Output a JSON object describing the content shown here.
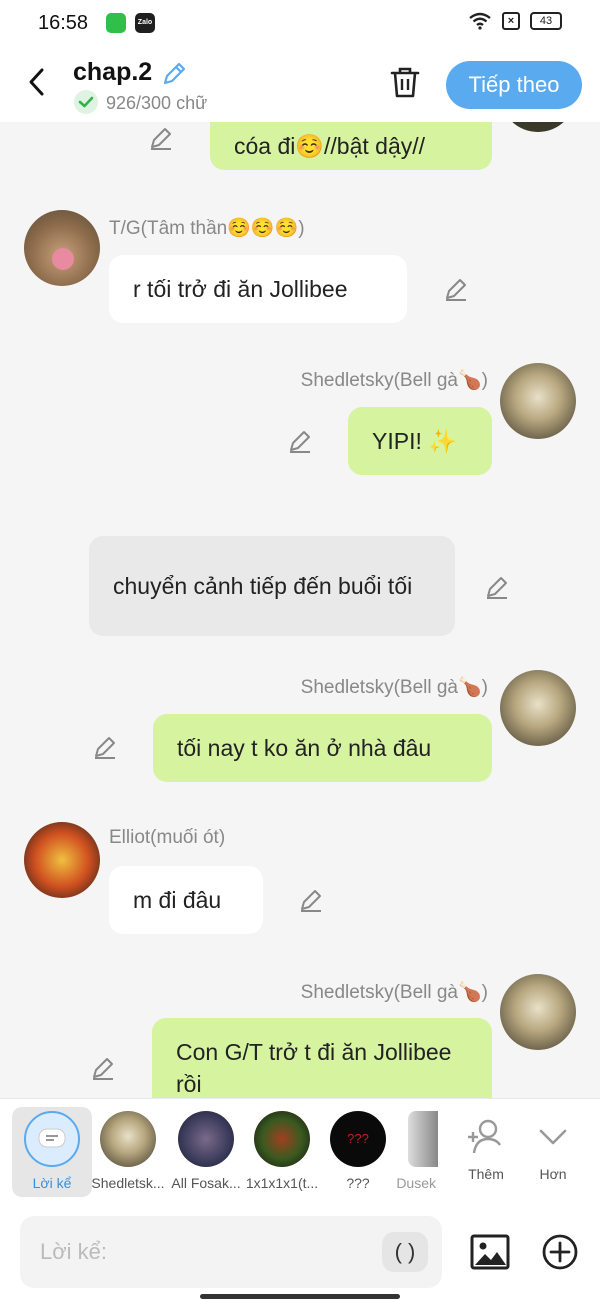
{
  "status_bar": {
    "time": "16:58",
    "zalo_label": "Zalo",
    "battery": "43"
  },
  "header": {
    "title": "chap.2",
    "word_count": "926/300 chữ",
    "next_label": "Tiếp theo"
  },
  "messages": [
    {
      "speaker": "",
      "text": "cóa đi☺️//bật dậy//"
    },
    {
      "speaker": "T/G(Tâm thần☺️☺️☺️)",
      "text": "r tối trở đi ăn Jollibee"
    },
    {
      "speaker": "Shedletsky(Bell gà🍗)",
      "text": "YIPI! ✨"
    },
    {
      "speaker": "",
      "text": "chuyển cảnh tiếp đến buổi tối"
    },
    {
      "speaker": "Shedletsky(Bell gà🍗)",
      "text": "tối nay t ko ăn ở nhà đâu"
    },
    {
      "speaker": "Elliot(muối ót)",
      "text": "m đi đâu"
    },
    {
      "speaker": "Shedletsky(Bell gà🍗)",
      "text": "Con G/T trở t đi ăn Jollibee rồi"
    }
  ],
  "characters": [
    {
      "label": "Lời kể"
    },
    {
      "label": "Shedletsk..."
    },
    {
      "label": "All Fosak..."
    },
    {
      "label": "1x1x1x1(t..."
    },
    {
      "label": "???"
    },
    {
      "label": "Dusek"
    }
  ],
  "more_buttons": {
    "add_label": "Thêm",
    "more_label": "Hơn"
  },
  "composer": {
    "placeholder": "Lời kể:",
    "paren_label": "( )"
  },
  "colors": {
    "accent": "#5aaaf0",
    "bubble_green": "#d6f3a0",
    "background": "#f5f5f5"
  }
}
